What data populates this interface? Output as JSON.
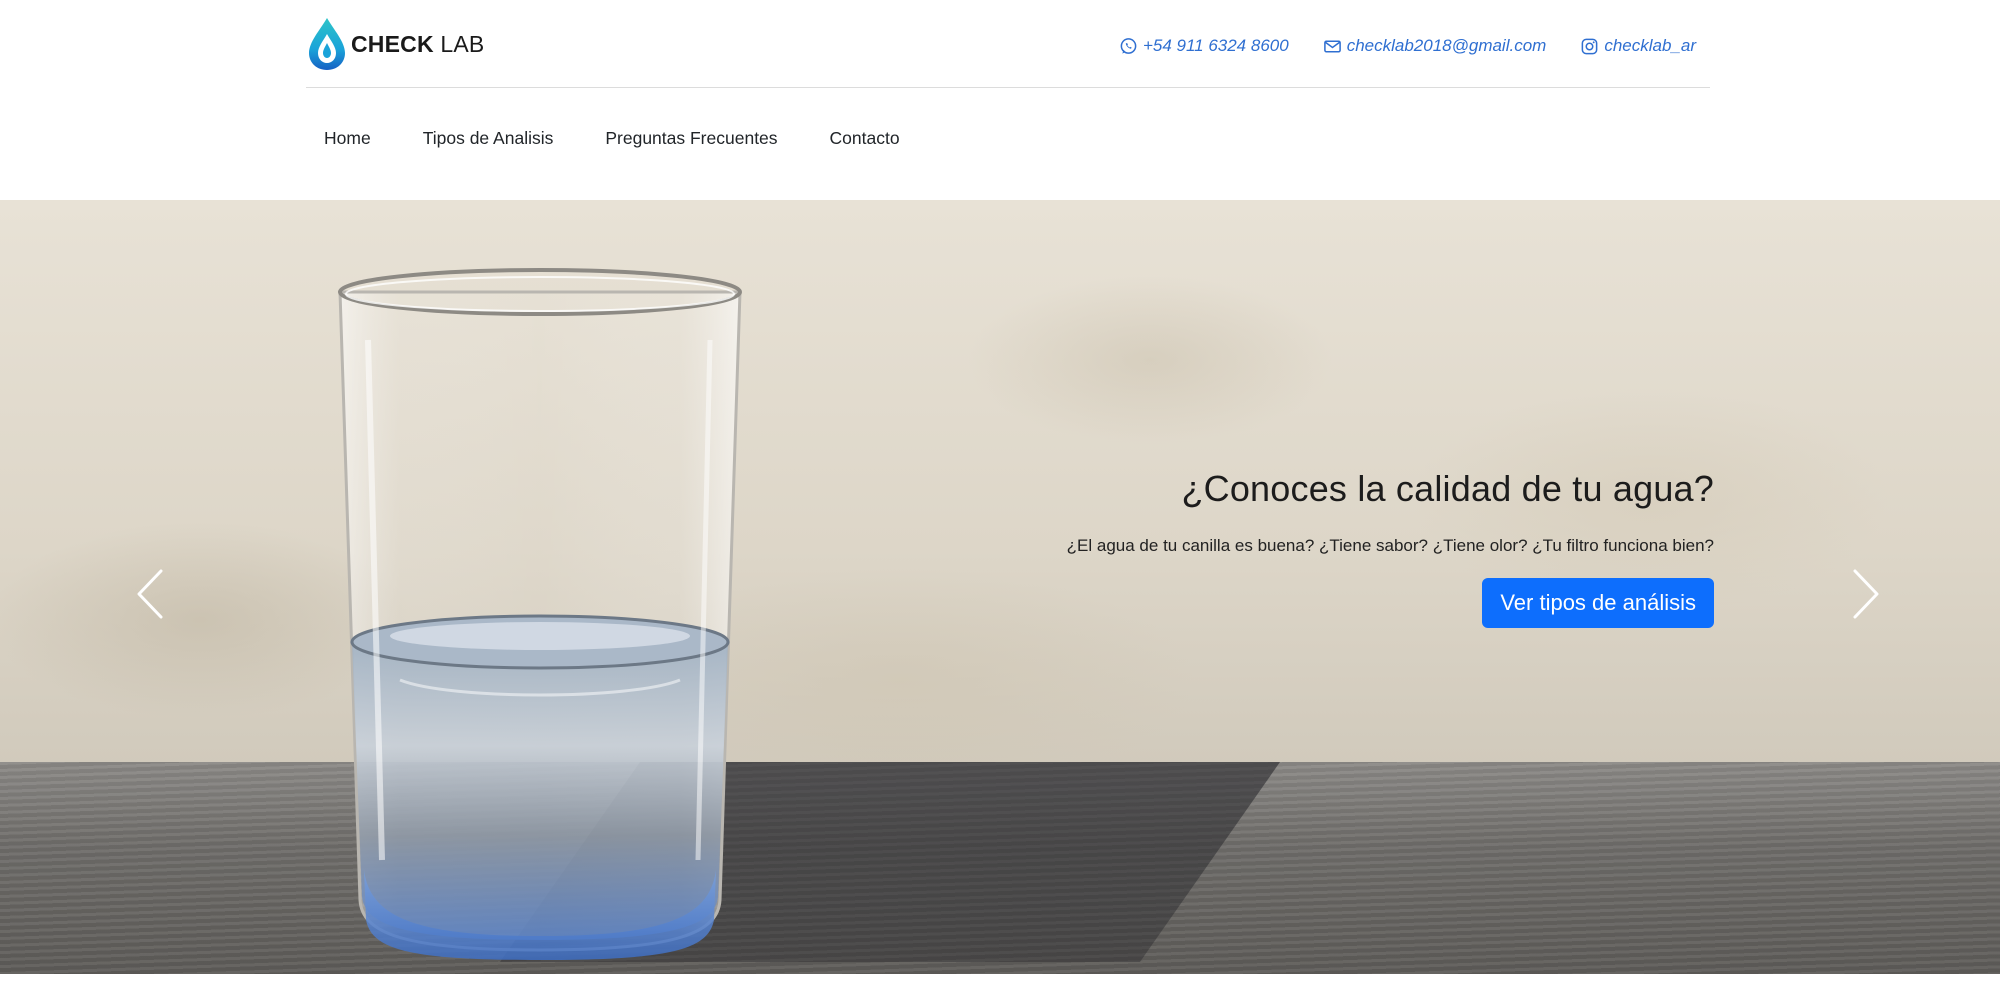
{
  "header": {
    "logo": {
      "bold": "CHECK",
      "light": "LAB",
      "icon": "water-drop-icon"
    },
    "contacts": [
      {
        "icon": "whatsapp-icon",
        "text": "+54 911 6324 8600"
      },
      {
        "icon": "mail-icon",
        "text": "checklab2018@gmail.com"
      },
      {
        "icon": "instagram-icon",
        "text": "checklab_ar"
      }
    ],
    "accent_color": "#2f6fd1"
  },
  "nav": {
    "items": [
      "Home",
      "Tipos de Analisis",
      "Preguntas Frecuentes",
      "Contacto"
    ]
  },
  "hero": {
    "title": "¿Conoces la calidad de tu agua?",
    "subtitle": "¿El agua de tu canilla es buena? ¿Tiene sabor? ¿Tiene olor? ¿Tu filtro funciona bien?",
    "cta_label": "Ver tipos de análisis",
    "cta_color": "#0d6efd",
    "prev_icon": "chevron-left-icon",
    "next_icon": "chevron-right-icon"
  }
}
